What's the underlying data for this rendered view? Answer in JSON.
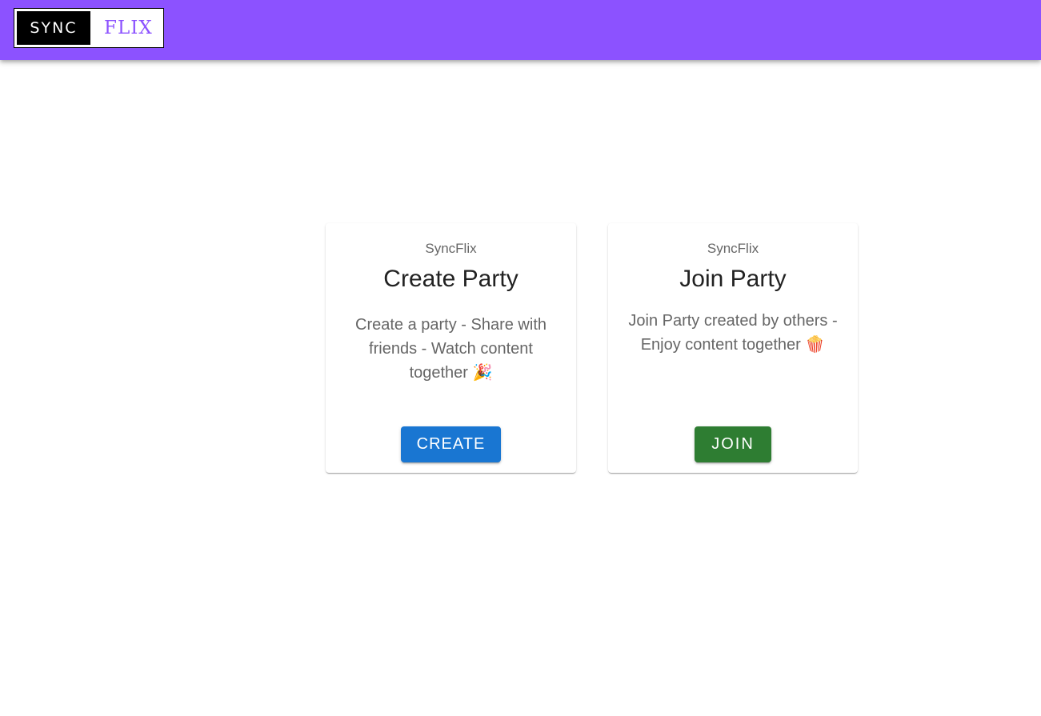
{
  "header": {
    "logo_sync": "SYNC",
    "logo_flix": "FLIX",
    "background_color": "#8c52ff"
  },
  "cards": [
    {
      "overline": "SyncFlix",
      "title": "Create Party",
      "description": "Create a party - Share with friends - Watch content together 🎉",
      "button_label": "CREATE",
      "button_color": "#1976d2"
    },
    {
      "overline": "SyncFlix",
      "title": "Join Party",
      "description": "Join Party created by others - Enjoy content together 🍿",
      "button_label": "JOIN",
      "button_color": "#2e7d32"
    }
  ]
}
